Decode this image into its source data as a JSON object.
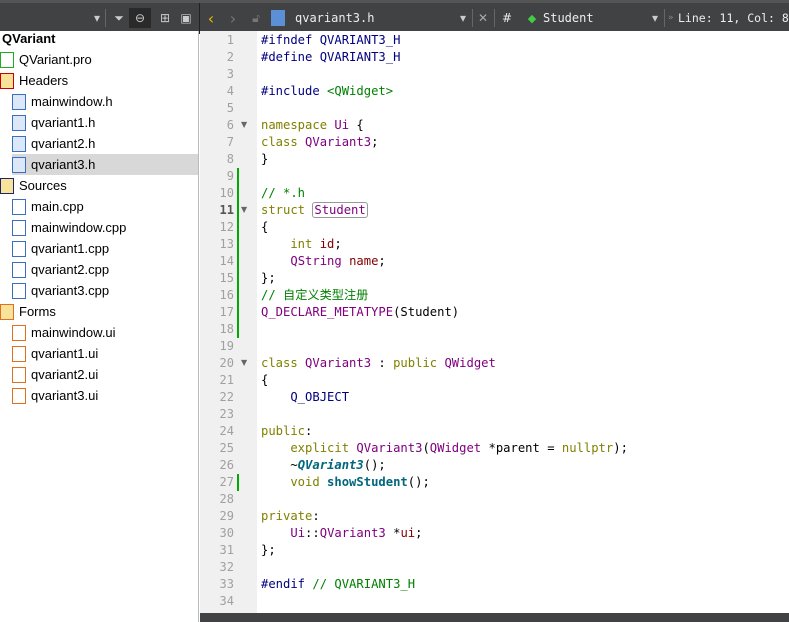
{
  "toolbar": {
    "file_name": "qvariant3.h",
    "hash": "#",
    "symbol": "Student",
    "position": "Line: 11, Col: 8"
  },
  "project": {
    "name": "QVariant",
    "items": [
      {
        "label": "QVariant.pro",
        "type": "pro",
        "indent": 0
      },
      {
        "label": "Headers",
        "type": "folder-h",
        "indent": 0
      },
      {
        "label": "mainwindow.h",
        "type": "h",
        "indent": 1
      },
      {
        "label": "qvariant1.h",
        "type": "h",
        "indent": 1
      },
      {
        "label": "qvariant2.h",
        "type": "h",
        "indent": 1
      },
      {
        "label": "qvariant3.h",
        "type": "h",
        "indent": 1,
        "selected": true
      },
      {
        "label": "Sources",
        "type": "folder-cpp",
        "indent": 0
      },
      {
        "label": "main.cpp",
        "type": "cpp",
        "indent": 1
      },
      {
        "label": "mainwindow.cpp",
        "type": "cpp",
        "indent": 1
      },
      {
        "label": "qvariant1.cpp",
        "type": "cpp",
        "indent": 1
      },
      {
        "label": "qvariant2.cpp",
        "type": "cpp",
        "indent": 1
      },
      {
        "label": "qvariant3.cpp",
        "type": "cpp",
        "indent": 1
      },
      {
        "label": "Forms",
        "type": "folder-ui",
        "indent": 0
      },
      {
        "label": "mainwindow.ui",
        "type": "ui",
        "indent": 1
      },
      {
        "label": "qvariant1.ui",
        "type": "ui",
        "indent": 1
      },
      {
        "label": "qvariant2.ui",
        "type": "ui",
        "indent": 1
      },
      {
        "label": "qvariant3.ui",
        "type": "ui",
        "indent": 1
      }
    ]
  },
  "editor": {
    "current_line": 11,
    "fold_lines": [
      6,
      11,
      20
    ],
    "changed_ranges": [
      [
        9,
        18
      ],
      [
        27,
        27
      ]
    ],
    "lines": [
      [
        [
          "#ifndef ",
          "pp"
        ],
        [
          "QVARIANT3_H",
          "pp"
        ]
      ],
      [
        [
          "#define ",
          "pp"
        ],
        [
          "QVARIANT3_H",
          "pp"
        ]
      ],
      [],
      [
        [
          "#include ",
          "pp"
        ],
        [
          "<QWidget>",
          "st"
        ]
      ],
      [],
      [
        [
          "namespace ",
          "kw"
        ],
        [
          "Ui",
          "ty"
        ],
        [
          " {",
          ""
        ]
      ],
      [
        [
          "class ",
          "kw"
        ],
        [
          "QVariant3",
          "ty"
        ],
        [
          ";",
          ""
        ]
      ],
      [
        [
          "}",
          ""
        ]
      ],
      [],
      [
        [
          "// *.h",
          "cm"
        ]
      ],
      [
        [
          "struct ",
          "kw"
        ],
        [
          "Student",
          "ty hl"
        ]
      ],
      [
        [
          "{",
          ""
        ]
      ],
      [
        [
          "    int ",
          "kw"
        ],
        [
          "id",
          "id"
        ],
        [
          ";",
          ""
        ]
      ],
      [
        [
          "    ",
          ""
        ],
        [
          "QString ",
          "ty"
        ],
        [
          "name",
          "id"
        ],
        [
          ";",
          ""
        ]
      ],
      [
        [
          "};",
          ""
        ]
      ],
      [
        [
          "// 自定义类型注册",
          "cm"
        ]
      ],
      [
        [
          "Q_DECLARE_METATYPE",
          "ty"
        ],
        [
          "(Student)",
          ""
        ]
      ],
      [],
      [],
      [
        [
          "class ",
          "kw"
        ],
        [
          "QVariant3",
          "ty"
        ],
        [
          " : ",
          ""
        ],
        [
          "public ",
          "kw"
        ],
        [
          "QWidget",
          "ty"
        ]
      ],
      [
        [
          "{",
          ""
        ]
      ],
      [
        [
          "    Q_OBJECT",
          "pp"
        ]
      ],
      [],
      [
        [
          "public",
          "kw"
        ],
        [
          ":",
          ""
        ]
      ],
      [
        [
          "    explicit ",
          "kw"
        ],
        [
          "QVariant3",
          "ty"
        ],
        [
          "(",
          ""
        ],
        [
          "QWidget",
          "ty"
        ],
        [
          " *parent = ",
          ""
        ],
        [
          "nullptr",
          "kw"
        ],
        [
          ");",
          ""
        ]
      ],
      [
        [
          "    ~",
          ""
        ],
        [
          "QVariant3",
          "it"
        ],
        [
          "();",
          ""
        ]
      ],
      [
        [
          "    void ",
          "kw"
        ],
        [
          "showStudent",
          "fn"
        ],
        [
          "();",
          ""
        ]
      ],
      [],
      [
        [
          "private",
          "kw"
        ],
        [
          ":",
          ""
        ]
      ],
      [
        [
          "    ",
          ""
        ],
        [
          "Ui",
          "ty"
        ],
        [
          "::",
          ""
        ],
        [
          "QVariant3",
          "ty"
        ],
        [
          " *",
          ""
        ],
        [
          "ui",
          "id"
        ],
        [
          ";",
          ""
        ]
      ],
      [
        [
          "};",
          ""
        ]
      ],
      [],
      [
        [
          "#endif ",
          "pp"
        ],
        [
          "// QVARIANT3_H",
          "cm"
        ]
      ],
      []
    ]
  }
}
